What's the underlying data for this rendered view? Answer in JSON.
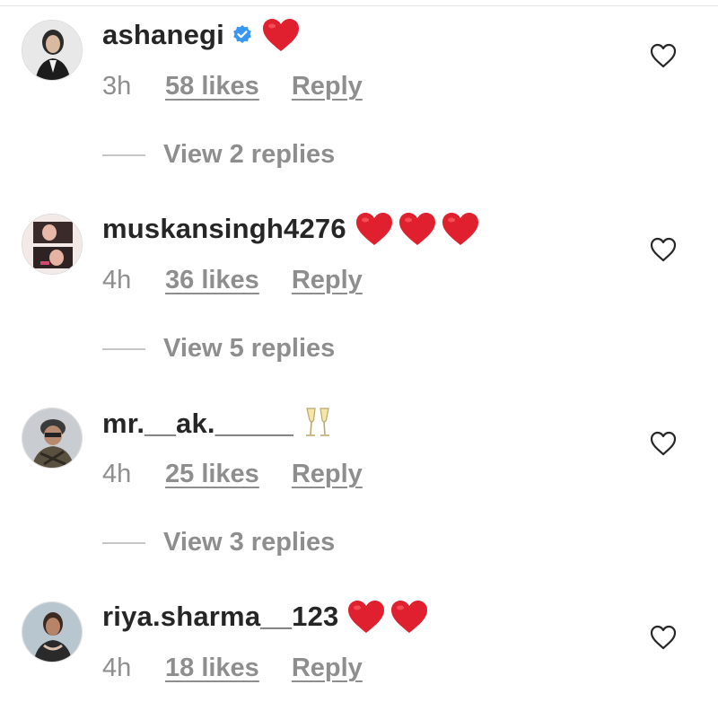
{
  "colors": {
    "username": "#262626",
    "meta_gray": "#8e8e8e",
    "verified_blue": "#3897f0",
    "heart_red": "#e0202e"
  },
  "comments": [
    {
      "username": "ashanegi",
      "verified": true,
      "emoji": [
        "red-heart"
      ],
      "time": "3h",
      "likes": "58 likes",
      "reply": "Reply",
      "view_replies": "View 2 replies"
    },
    {
      "username": "muskansingh4276",
      "verified": false,
      "emoji": [
        "red-heart",
        "red-heart",
        "red-heart"
      ],
      "time": "4h",
      "likes": "36 likes",
      "reply": "Reply",
      "view_replies": "View 5 replies"
    },
    {
      "username": "mr.__ak._____",
      "verified": false,
      "emoji": [
        "champagne-glasses"
      ],
      "time": "4h",
      "likes": "25 likes",
      "reply": "Reply",
      "view_replies": "View 3 replies"
    },
    {
      "username": "riya.sharma__123",
      "verified": false,
      "emoji": [
        "red-heart",
        "red-heart"
      ],
      "time": "4h",
      "likes": "18 likes",
      "reply": "Reply"
    }
  ]
}
